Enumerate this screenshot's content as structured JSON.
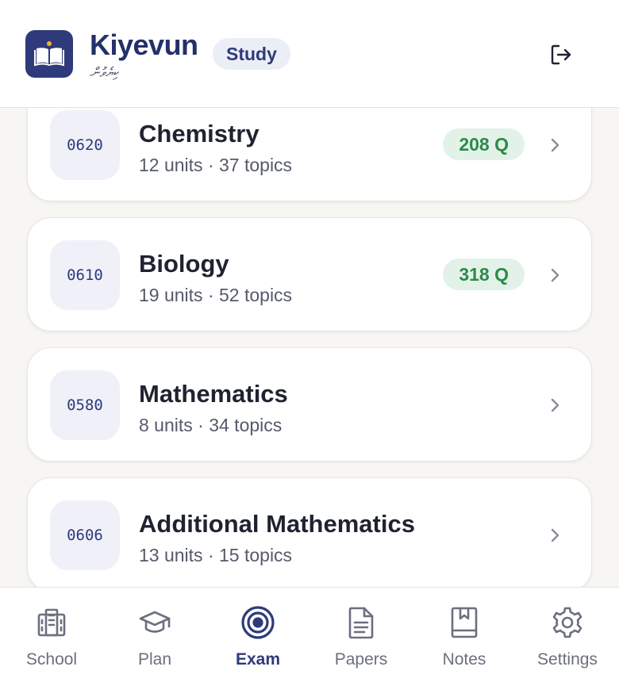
{
  "header": {
    "title": "Kiyevun",
    "subtitle": "ކިޔެވުން",
    "mode_pill": "Study",
    "logout_icon": "logout-icon",
    "logo_icon": "book-icon",
    "brand_color": "#2e3a7a"
  },
  "courses": [
    {
      "code": "0620",
      "name": "Chemistry",
      "meta": "12 units · 37 topics",
      "questions": "208 Q"
    },
    {
      "code": "0610",
      "name": "Biology",
      "meta": "19 units · 52 topics",
      "questions": "318 Q"
    },
    {
      "code": "0580",
      "name": "Mathematics",
      "meta": "8 units · 34 topics",
      "questions": ""
    },
    {
      "code": "0606",
      "name": "Additional Mathematics",
      "meta": "13 units · 15 topics",
      "questions": ""
    }
  ],
  "nav": {
    "active": "Exam",
    "items": [
      {
        "label": "School",
        "icon": "building-icon"
      },
      {
        "label": "Plan",
        "icon": "graduation-cap-icon"
      },
      {
        "label": "Exam",
        "icon": "target-icon"
      },
      {
        "label": "Papers",
        "icon": "document-icon"
      },
      {
        "label": "Notes",
        "icon": "notebook-icon"
      },
      {
        "label": "Settings",
        "icon": "gear-icon"
      }
    ]
  },
  "colors": {
    "accent": "#2e3a7a",
    "badge_bg": "#e3f2e8",
    "badge_text": "#2c8a4a",
    "inactive": "#6b6f7e"
  }
}
